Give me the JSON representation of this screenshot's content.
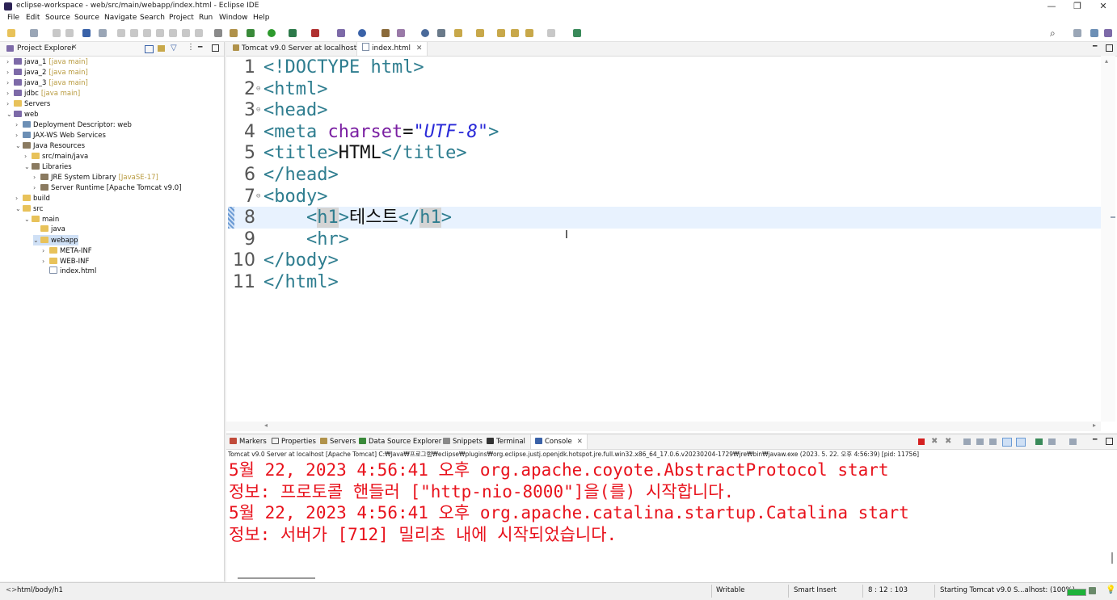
{
  "window": {
    "title": "eclipse-workspace - web/src/main/webapp/index.html - Eclipse IDE",
    "controls": [
      "—",
      "❐",
      "✕"
    ]
  },
  "menu": [
    "File",
    "Edit",
    "Source",
    "Source",
    "Navigate",
    "Search",
    "Project",
    "Run",
    "Window",
    "Help"
  ],
  "explorer": {
    "tab_label": "Project Explorer",
    "items": [
      {
        "label": "java_1",
        "deco": "[java main]",
        "indent": 0,
        "arrow": "›",
        "icon": "proj"
      },
      {
        "label": "java_2",
        "deco": "[java main]",
        "indent": 0,
        "arrow": "›",
        "icon": "proj"
      },
      {
        "label": "java_3",
        "deco": "[java main]",
        "indent": 0,
        "arrow": "›",
        "icon": "proj"
      },
      {
        "label": "jdbc",
        "deco": "[java main]",
        "indent": 0,
        "arrow": "›",
        "icon": "proj"
      },
      {
        "label": "Servers",
        "deco": "",
        "indent": 0,
        "arrow": "›",
        "icon": "folder"
      },
      {
        "label": "web",
        "deco": "",
        "indent": 0,
        "arrow": "⌄",
        "icon": "proj"
      },
      {
        "label": "Deployment Descriptor: web",
        "deco": "",
        "indent": 1,
        "arrow": "›",
        "icon": "other"
      },
      {
        "label": "JAX-WS Web Services",
        "deco": "",
        "indent": 1,
        "arrow": "›",
        "icon": "other"
      },
      {
        "label": "Java Resources",
        "deco": "",
        "indent": 1,
        "arrow": "⌄",
        "icon": "lib"
      },
      {
        "label": "src/main/java",
        "deco": "",
        "indent": 2,
        "arrow": "›",
        "icon": "folder"
      },
      {
        "label": "Libraries",
        "deco": "",
        "indent": 2,
        "arrow": "⌄",
        "icon": "lib"
      },
      {
        "label": "JRE System Library",
        "deco": "[JavaSE-17]",
        "indent": 3,
        "arrow": "›",
        "icon": "lib"
      },
      {
        "label": "Server Runtime [Apache Tomcat v9.0]",
        "deco": "",
        "indent": 3,
        "arrow": "›",
        "icon": "lib"
      },
      {
        "label": "build",
        "deco": "",
        "indent": 1,
        "arrow": "›",
        "icon": "folder"
      },
      {
        "label": "src",
        "deco": "",
        "indent": 1,
        "arrow": "⌄",
        "icon": "folder"
      },
      {
        "label": "main",
        "deco": "",
        "indent": 2,
        "arrow": "⌄",
        "icon": "folder"
      },
      {
        "label": "java",
        "deco": "",
        "indent": 3,
        "arrow": "",
        "icon": "folder"
      },
      {
        "label": "webapp",
        "deco": "",
        "indent": 3,
        "arrow": "⌄",
        "icon": "folder",
        "selected": true
      },
      {
        "label": "META-INF",
        "deco": "",
        "indent": 4,
        "arrow": "›",
        "icon": "folder"
      },
      {
        "label": "WEB-INF",
        "deco": "",
        "indent": 4,
        "arrow": "›",
        "icon": "folder"
      },
      {
        "label": "index.html",
        "deco": "",
        "indent": 4,
        "arrow": "",
        "icon": "file"
      }
    ]
  },
  "editor": {
    "tabs": [
      {
        "label": "Tomcat v9.0 Server at localhost",
        "active": false
      },
      {
        "label": "index.html",
        "active": true,
        "close": "✕"
      }
    ],
    "lines": [
      {
        "num": "1",
        "fold": "",
        "parts": [
          [
            "tg",
            "<!DOCTYPE html>"
          ]
        ]
      },
      {
        "num": "2",
        "fold": "⊖",
        "parts": [
          [
            "tg",
            "<html>"
          ]
        ]
      },
      {
        "num": "3",
        "fold": "⊖",
        "parts": [
          [
            "tg",
            "<head>"
          ]
        ]
      },
      {
        "num": "4",
        "fold": "",
        "parts": [
          [
            "tg",
            "<meta "
          ],
          [
            "attr",
            "charset"
          ],
          [
            "txt",
            "="
          ],
          [
            "str",
            "\"UTF-8\""
          ],
          [
            "tg",
            ">"
          ]
        ]
      },
      {
        "num": "5",
        "fold": "",
        "parts": [
          [
            "tg",
            "<title>"
          ],
          [
            "txt",
            "HTML"
          ],
          [
            "tg",
            "</title>"
          ]
        ]
      },
      {
        "num": "6",
        "fold": "",
        "parts": [
          [
            "tg",
            "</head>"
          ]
        ]
      },
      {
        "num": "7",
        "fold": "⊖",
        "parts": [
          [
            "tg",
            "<body>"
          ]
        ]
      },
      {
        "num": "8",
        "fold": "",
        "parts": [
          [
            "txt",
            "    "
          ],
          [
            "tg",
            "<"
          ],
          [
            "hl",
            "h1"
          ],
          [
            "tg",
            ">"
          ],
          [
            "txt",
            "테스트"
          ],
          [
            "tg",
            "</"
          ],
          [
            "hl",
            "h1"
          ],
          [
            "tg",
            ">"
          ]
        ]
      },
      {
        "num": "9",
        "fold": "",
        "parts": [
          [
            "txt",
            "    "
          ],
          [
            "tg",
            "<hr>"
          ]
        ]
      },
      {
        "num": "10",
        "fold": "",
        "parts": [
          [
            "tg",
            "</body>"
          ]
        ]
      },
      {
        "num": "11",
        "fold": "",
        "parts": [
          [
            "tg",
            "</html>"
          ]
        ]
      }
    ]
  },
  "console": {
    "tabs": [
      "Markers",
      "Properties",
      "Servers",
      "Data Source Explorer",
      "Snippets",
      "Terminal",
      "Console"
    ],
    "active_tab": "Console",
    "description": "Tomcat v9.0 Server at localhost [Apache Tomcat] C:₩Java₩프로그램₩eclipse₩plugins₩org.eclipse.justj.openjdk.hotspot.jre.full.win32.x86_64_17.0.6.v20230204-1729₩jre₩bin₩javaw.exe  (2023. 5. 22. 오후 4:56:39) [pid: 11756]",
    "lines": [
      "5월 22, 2023 4:56:41 오후 org.apache.coyote.AbstractProtocol start",
      "정보: 프로토콜 핸들러 [\"http-nio-8000\"]을(를) 시작합니다.",
      "5월 22, 2023 4:56:41 오후 org.apache.catalina.startup.Catalina start",
      "정보: 서버가 [712] 밀리초 내에 시작되었습니다."
    ],
    "text_color": "#e8121c"
  },
  "status": {
    "path": "html/body/h1",
    "writable": "Writable",
    "insert_mode": "Smart Insert",
    "position": "8 : 12 : 103",
    "progress_text": "Starting Tomcat v9.0 S...alhost: (100%)",
    "progress": 1.0
  },
  "colors": {
    "tag": "#2e7d8f",
    "attr": "#7a1fa2",
    "string": "#2a2ad8",
    "progress": "#1fb23a"
  }
}
